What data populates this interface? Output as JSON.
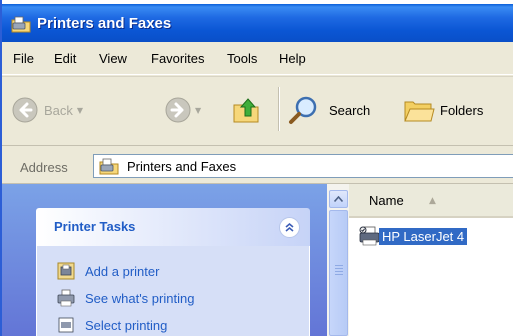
{
  "window": {
    "title": "Printers and Faxes",
    "title_icon": "printers-folder-icon"
  },
  "menubar": {
    "items": [
      "File",
      "Edit",
      "View",
      "Favorites",
      "Tools",
      "Help"
    ]
  },
  "toolbar": {
    "back_label": "Back",
    "search_label": "Search",
    "folders_label": "Folders"
  },
  "address": {
    "label": "Address",
    "value": "Printers and Faxes"
  },
  "taskpane": {
    "title": "Printer Tasks",
    "tasks": [
      "Add a printer",
      "See what's printing",
      "Select printing"
    ]
  },
  "filelist": {
    "column_name": "Name",
    "items": [
      {
        "name": "HP LaserJet 4",
        "selected": true
      }
    ]
  },
  "colors": {
    "titlebar": "#0b56d4",
    "taskpane_bg": "#6f8fe0",
    "task_link": "#215dc6",
    "selection": "#316ac5"
  }
}
